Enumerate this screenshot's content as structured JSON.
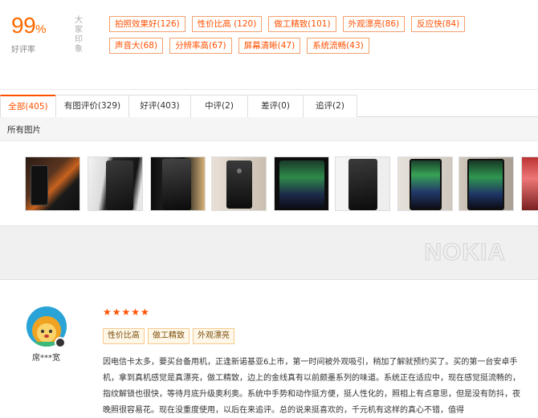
{
  "summary": {
    "score": "99",
    "score_unit": "%",
    "score_label": "好评率",
    "impression_label": "大家印象",
    "tags": [
      "拍照效果好(126)",
      "性价比高 (120)",
      "做工精致(101)",
      "外观漂亮(86)",
      "反应快(84)",
      "声音大(68)",
      "分辨率高(67)",
      "屏幕清晰(47)",
      "系统流畅(43)"
    ]
  },
  "tabs": [
    {
      "label": "全部(405)"
    },
    {
      "label": "有图评价(329)"
    },
    {
      "label": "好评(403)"
    },
    {
      "label": "中评(2)"
    },
    {
      "label": "差评(0)"
    },
    {
      "label": "追评(2)"
    }
  ],
  "photos": {
    "title": "所有图片"
  },
  "preview": {
    "watermark": "NOKIA"
  },
  "review": {
    "username": "席***宽",
    "stars": "★★★★★",
    "tags": [
      "性价比高",
      "做工精致",
      "外观漂亮"
    ],
    "text": "因电信卡太多，要买台备用机，正逢新诺基亚6上市，第一时间被外观吸引，稍加了解就预约买了。买的第一台安卓手机，拿到真机感觉是真漂亮，做工精致，边上的金线真有以前颇墨系列的味道。系统正在适应中，现在感觉挺流畅的，指纹解锁也很快，等待月底升级奥利奥。系统中手势和动作挺方便，挺人性化的，照相上有点意思，但是没有防抖，夜晚照很容易花。现在没重度使用，以后在来追评。总的说来挺喜欢的，千元机有这样的真心不错，值得"
  },
  "colors": {
    "accent": "#ff5000",
    "score": "#ff6a00"
  }
}
